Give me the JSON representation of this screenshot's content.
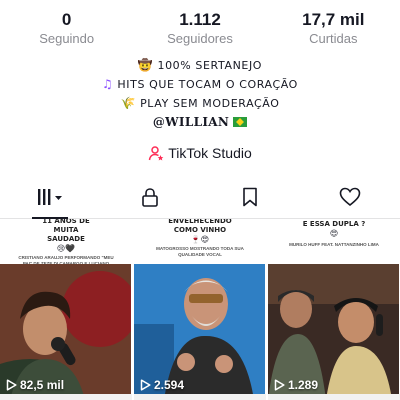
{
  "stats": [
    {
      "value": "0",
      "label": "Seguindo"
    },
    {
      "value": "1.112",
      "label": "Seguidores"
    },
    {
      "value": "17,7 mil",
      "label": "Curtidas"
    }
  ],
  "bio": {
    "line1": "100% SERTANEJO",
    "line2": "HITS QUE TOCAM O CORAÇÃO",
    "line3": "PLAY SEM MODERAÇÃO",
    "handle": "@WILLIAN"
  },
  "studio": {
    "label": "TikTok Studio"
  },
  "tabs": [
    {
      "icon": "grid-icon",
      "active": true
    },
    {
      "icon": "lock-icon",
      "active": false
    },
    {
      "icon": "bookmark-icon",
      "active": false
    },
    {
      "icon": "heart-icon",
      "active": false
    }
  ],
  "videos": [
    {
      "title": "11 ANOS DE MUITA SAUDADE",
      "subtitle": "CRISTIANO ARAUJO PERFORMANDO \"MEU PAI\" DE ZEZE DI CAMARGO E LUCIANO",
      "views": "82,5 mil"
    },
    {
      "title": "ENVELHECENDO COMO VINHO",
      "subtitle": "MATOGROSSO MOSTRANDO TODA SUA QUALIDADE VOCAL",
      "views": "2.594"
    },
    {
      "title": "E ESSA DUPLA ?",
      "subtitle": "MURILO HUFF FEAT. NATTANZINHO LIMA",
      "views": "1.289"
    }
  ],
  "colors": {
    "text": "#161823",
    "muted": "#8a8b91",
    "studio_pink": "#fe2c55"
  }
}
